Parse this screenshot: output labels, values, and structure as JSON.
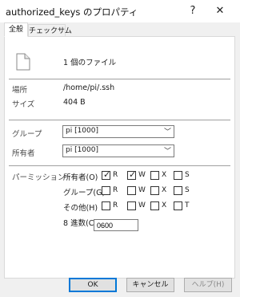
{
  "window": {
    "title": "authorized_keys のプロパティ",
    "help_glyph": "?",
    "close_glyph": "✕"
  },
  "tabs": [
    {
      "label": "全般",
      "active": true
    },
    {
      "label": "チェックサム",
      "active": false
    }
  ],
  "file": {
    "icon": "file-icon",
    "count_text": "1 個のファイル"
  },
  "info": {
    "location_label": "場所",
    "location_value": "/home/pi/.ssh",
    "size_label": "サイズ",
    "size_value": "404 B"
  },
  "ownership": {
    "group_label": "グループ",
    "group_value": "pi [1000]",
    "owner_label": "所有者",
    "owner_value": "pi [1000]",
    "dropdown_glyph": "﹀"
  },
  "permissions": {
    "section_label": "パーミッション",
    "check_glyph": "✓",
    "rows": [
      {
        "label": "所有者(O)",
        "r": "R",
        "w": "W",
        "x": "X",
        "s": "S",
        "r_checked": true,
        "w_checked": true,
        "x_checked": false,
        "s_checked": false
      },
      {
        "label": "グループ(G)",
        "r": "R",
        "w": "W",
        "x": "X",
        "s": "S",
        "r_checked": false,
        "w_checked": false,
        "x_checked": false,
        "s_checked": false
      },
      {
        "label": "その他(H)",
        "r": "R",
        "w": "W",
        "x": "X",
        "s": "T",
        "r_checked": false,
        "w_checked": false,
        "x_checked": false,
        "s_checked": false
      }
    ],
    "octal_label": "8 進数(C)",
    "octal_value": "0600"
  },
  "buttons": {
    "ok": "OK",
    "cancel": "キャンセル",
    "help": "ヘルプ(H)"
  },
  "colors": {
    "accent": "#0078d7",
    "dialog_bg": "#f0f0f0",
    "panel_bg": "#ffffff"
  }
}
